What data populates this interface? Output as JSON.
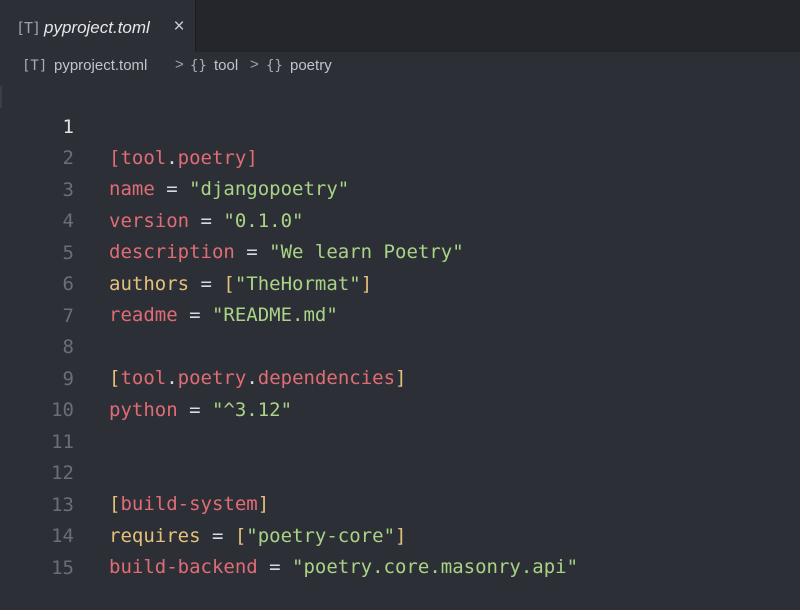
{
  "tab": {
    "file_icon": "[T]",
    "filename": "pyproject.toml",
    "close_glyph": "×"
  },
  "breadcrumb": {
    "file_icon": "[T]",
    "file": "pyproject.toml",
    "separator": ">",
    "obj_icon": "{}",
    "item1": "tool",
    "item2": "poetry"
  },
  "editor": {
    "active_line": 1,
    "line_numbers": [
      "1",
      "2",
      "3",
      "4",
      "5",
      "6",
      "7",
      "8",
      "9",
      "10",
      "11",
      "12",
      "13",
      "14",
      "15"
    ],
    "lines": {
      "l1": {
        "open": "[",
        "a": "tool",
        "dot": ".",
        "b": "poetry",
        "close": "]"
      },
      "l2": {
        "key": "name",
        "op": " = ",
        "val": "\"djangopoetry\""
      },
      "l3": {
        "key": "version",
        "op": " = ",
        "val": "\"0.1.0\""
      },
      "l4": {
        "key": "description",
        "op": " = ",
        "val": "\"We learn Poetry\""
      },
      "l5": {
        "key": "authors",
        "op": " = ",
        "open": "[",
        "val": "\"TheHormat\"",
        "close": "]"
      },
      "l6": {
        "key": "readme",
        "op": " = ",
        "val": "\"README.md\""
      },
      "l8": {
        "open": "[",
        "a": "tool",
        "dot1": ".",
        "b": "poetry",
        "dot2": ".",
        "c": "dependencies",
        "close": "]"
      },
      "l9": {
        "key": "python",
        "op": " = ",
        "val": "\"^3.12\""
      },
      "l12": {
        "open": "[",
        "a": "build-system",
        "close": "]"
      },
      "l13": {
        "key": "requires",
        "op": " = ",
        "open": "[",
        "val": "\"poetry-core\"",
        "close": "]"
      },
      "l14": {
        "key": "build-backend",
        "op": " = ",
        "val": "\"poetry.core.masonry.api\""
      }
    }
  },
  "colors": {
    "background": "#2d2f36",
    "tabbar": "#24262b",
    "key": "#e06c75",
    "key_highlight": "#e5c07b",
    "string": "#a9d386",
    "line_number": "#6a6e77"
  }
}
